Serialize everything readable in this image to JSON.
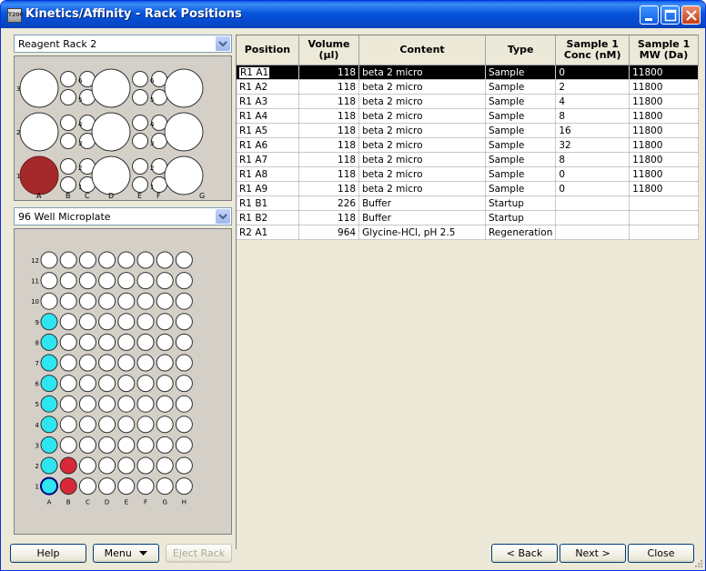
{
  "window": {
    "title": "Kinetics/Affinity - Rack Positions",
    "app_icon_text": "T200"
  },
  "reagent_rack": {
    "selected": "Reagent Rack 2",
    "row_labels": [
      "3",
      "2",
      "1"
    ],
    "col_labels": [
      "A",
      "B",
      "C",
      "D",
      "E",
      "F",
      "G"
    ],
    "small_labels": [
      "6",
      "5",
      "4",
      "3",
      "2",
      "1"
    ],
    "occupied_well": "A1",
    "occupied_color": "#a5292a"
  },
  "microplate": {
    "selected": "96 Well Microplate",
    "row_labels": [
      "12",
      "11",
      "10",
      "9",
      "8",
      "7",
      "6",
      "5",
      "4",
      "3",
      "2",
      "1"
    ],
    "col_labels": [
      "A",
      "B",
      "C",
      "D",
      "E",
      "F",
      "G",
      "H"
    ],
    "cyan_wells": [
      "A9",
      "A8",
      "A7",
      "A6",
      "A5",
      "A4",
      "A3",
      "A2",
      "A1"
    ],
    "red_wells": [
      "B2",
      "B1"
    ],
    "highlight_well": "A1",
    "cyan_color": "#2ee6f0",
    "red_color": "#d8283a"
  },
  "table": {
    "headers": [
      "Position",
      "Volume (µl)",
      "Content",
      "Type",
      "Sample 1 Conc (nM)",
      "Sample 1 MW (Da)"
    ],
    "rows": [
      [
        "R1 A1",
        "118",
        "beta 2 micro",
        "Sample",
        "0",
        "11800"
      ],
      [
        "R1 A2",
        "118",
        "beta 2 micro",
        "Sample",
        "2",
        "11800"
      ],
      [
        "R1 A3",
        "118",
        "beta 2 micro",
        "Sample",
        "4",
        "11800"
      ],
      [
        "R1 A4",
        "118",
        "beta 2 micro",
        "Sample",
        "8",
        "11800"
      ],
      [
        "R1 A5",
        "118",
        "beta 2 micro",
        "Sample",
        "16",
        "11800"
      ],
      [
        "R1 A6",
        "118",
        "beta 2 micro",
        "Sample",
        "32",
        "11800"
      ],
      [
        "R1 A7",
        "118",
        "beta 2 micro",
        "Sample",
        "8",
        "11800"
      ],
      [
        "R1 A8",
        "118",
        "beta 2 micro",
        "Sample",
        "0",
        "11800"
      ],
      [
        "R1 A9",
        "118",
        "beta 2 micro",
        "Sample",
        "0",
        "11800"
      ],
      [
        "R1 B1",
        "226",
        "Buffer",
        "Startup",
        "",
        ""
      ],
      [
        "R1 B2",
        "118",
        "Buffer",
        "Startup",
        "",
        ""
      ],
      [
        "R2 A1",
        "964",
        "Glycine-HCl, pH 2.5",
        "Regeneration",
        "",
        ""
      ]
    ],
    "selected_row": 0
  },
  "buttons": {
    "help": "Help",
    "menu": "Menu",
    "eject": "Eject Rack",
    "back": "< Back",
    "next": "Next >",
    "close": "Close"
  },
  "icons": {
    "minimize": "minimize-icon",
    "maximize": "maximize-icon",
    "close": "close-x-icon",
    "dropdown": "chevron-down-icon",
    "menu_arrow": "triangle-down-icon"
  }
}
